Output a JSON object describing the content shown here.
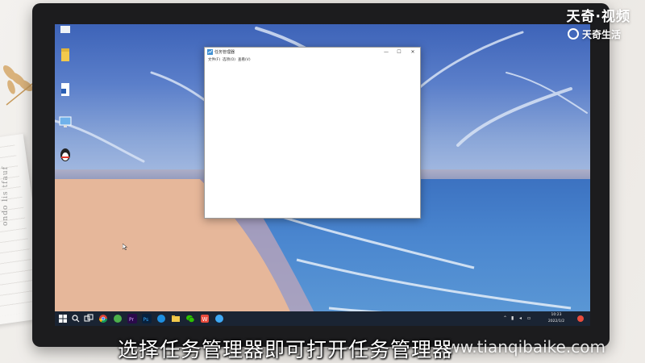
{
  "brand": {
    "main": "天奇·视频",
    "sub": "天奇生活"
  },
  "caption": "选择任务管理器即可打开任务管理器",
  "watermark": "www.tianqibaike.com",
  "notebook_text": "ondo lis tfauf",
  "desktop": {
    "icons": [
      {
        "label": "",
        "icon": "folder-icon"
      },
      {
        "label": "",
        "icon": "word-document-icon"
      },
      {
        "label": "",
        "icon": "network-icon"
      },
      {
        "label": "",
        "icon": "qq-penguin-icon"
      }
    ]
  },
  "window": {
    "title": "任务管理器",
    "menu": [
      "文件(F)",
      "选项(O)",
      "查看(V)"
    ],
    "buttons": {
      "minimize": "—",
      "maximize": "☐",
      "close": "✕"
    }
  },
  "taskbar": {
    "icons": [
      "windows-start-icon",
      "search-icon",
      "task-view-icon",
      "chrome-icon",
      "premiere-icon",
      "photoshop-icon",
      "edge-icon",
      "file-explorer-icon",
      "wechat-icon",
      "wps-icon",
      "qq-icon"
    ],
    "time": "10:23",
    "date": "2022/1/2"
  },
  "colors": {
    "taskbar": "#1a2433",
    "bezel": "#1c1c1e",
    "sea": "#3e73c0",
    "sand": "#e6b79a"
  }
}
